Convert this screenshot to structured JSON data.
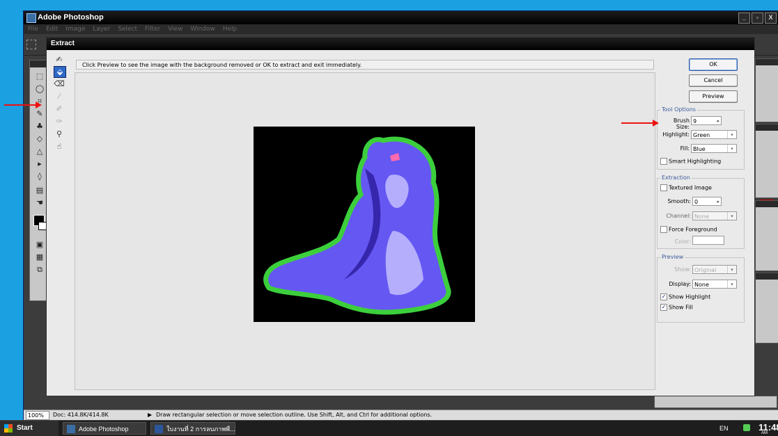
{
  "app": {
    "title": "Adobe Photoshop",
    "menu": [
      "File",
      "Edit",
      "Image",
      "Layer",
      "Select",
      "Filter",
      "View",
      "Window",
      "Help"
    ],
    "window_buttons": [
      "_",
      "▫",
      "X"
    ]
  },
  "dialog": {
    "title": "Extract",
    "instruction": "Click Preview to see the image with the background removed or OK to extract and exit immediately.",
    "buttons": {
      "ok": "OK",
      "cancel": "Cancel",
      "preview": "Preview"
    },
    "tool_options": {
      "title": "Tool Options",
      "brush_size_label": "Brush Size:",
      "brush_size": "9",
      "highlight_label": "Highlight:",
      "highlight": "Green",
      "fill_label": "Fill:",
      "fill": "Blue",
      "smart_highlighting": "Smart Highlighting"
    },
    "extraction": {
      "title": "Extraction",
      "textured_image": "Textured Image",
      "smooth_label": "Smooth:",
      "smooth": "0",
      "channel_label": "Channel:",
      "channel": "None",
      "force_foreground": "Force Foreground",
      "color_label": "Color:"
    },
    "preview": {
      "title": "Preview",
      "show_label": "Show:",
      "show": "Original",
      "display_label": "Display:",
      "display": "None",
      "show_highlight": "Show Highlight",
      "show_fill": "Show Fill"
    },
    "colors": {
      "highlight": "#3ccf3c",
      "fill": "#6a5cff"
    }
  },
  "status": {
    "zoom": "100%",
    "doc": "Doc: 414.8K/414.8K",
    "hint": "Draw rectangular selection or move selection outline.  Use Shift, Alt, and Ctrl for additional options."
  },
  "taskbar": {
    "start": "Start",
    "tasks": [
      "Adobe Photoshop",
      "ใบงานที่ 2 การลบภาพพื..."
    ],
    "lang": "EN",
    "time": "11:48",
    "ampm": "AM"
  }
}
